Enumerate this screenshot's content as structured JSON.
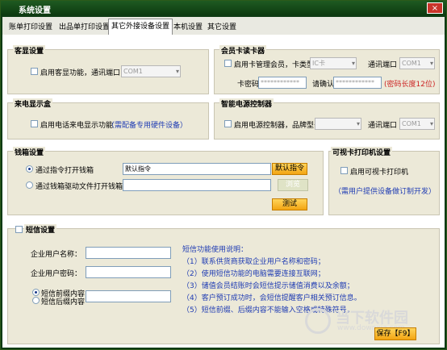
{
  "window": {
    "title": "系统设置",
    "close": "×"
  },
  "tabs": [
    "账单打印设置",
    "出品单打印设置",
    "其它外接设备设置",
    "本机设置",
    "其它设置"
  ],
  "customer_display": {
    "title": "客显设置",
    "enable_label": "启用客显功能，通讯端口",
    "port_value": "COM1"
  },
  "member_card": {
    "title": "会员卡读卡器",
    "enable_label": "启用卡管理会员，卡类型",
    "card_type": "IC卡",
    "port_label": "通讯端口",
    "port_value": "COM1",
    "password_label": "卡密码",
    "password_value": "************",
    "confirm_label": "请确认",
    "confirm_value": "************",
    "length_hint": "(密码长度12位)"
  },
  "caller_id": {
    "title": "来电显示盒",
    "enable_label": "启用电话来电显示功能",
    "hint": "（需配备专用硬件设备）"
  },
  "power_controller": {
    "title": "智能电源控制器",
    "enable_label": "启用电源控制器，品牌型号",
    "model_value": "",
    "port_label": "通讯端口",
    "port_value": "COM1"
  },
  "cash_drawer": {
    "title": "钱箱设置",
    "option_command": "通过指令打开钱箱",
    "option_driver": "通过钱箱驱动文件打开钱箱",
    "command_value": "默认指令",
    "default_button": "默认指令",
    "browse_button": "浏览",
    "test_button": "测试"
  },
  "visual_card_printer": {
    "title": "可视卡打印机设置",
    "enable_label": "启用可视卡打印机",
    "hint": "（需用户提供设备做订制开发）"
  },
  "sms": {
    "title": "短信设置",
    "company_name_label": "企业用户名称：",
    "company_password_label": "企业用户密码：",
    "prefix_label": "短信前缀内容",
    "suffix_label": "短信后缀内容",
    "help_title": "短信功能使用说明：",
    "help_lines": [
      "（1）联系供货商获取企业用户名称和密码；",
      "（2）使用短信功能的电脑需要连接互联网；",
      "（3）储值会员结账时会短信提示储值消费以及余额；",
      "（4）客户预订成功时，会短信提醒客户相关预订信息。",
      "（5）短信前缀、后缀内容不能输入空格或特殊符号。"
    ]
  },
  "save_button": "保存【F9】",
  "watermark": {
    "main": "当下软件园",
    "sub": "www.downxia.com"
  }
}
